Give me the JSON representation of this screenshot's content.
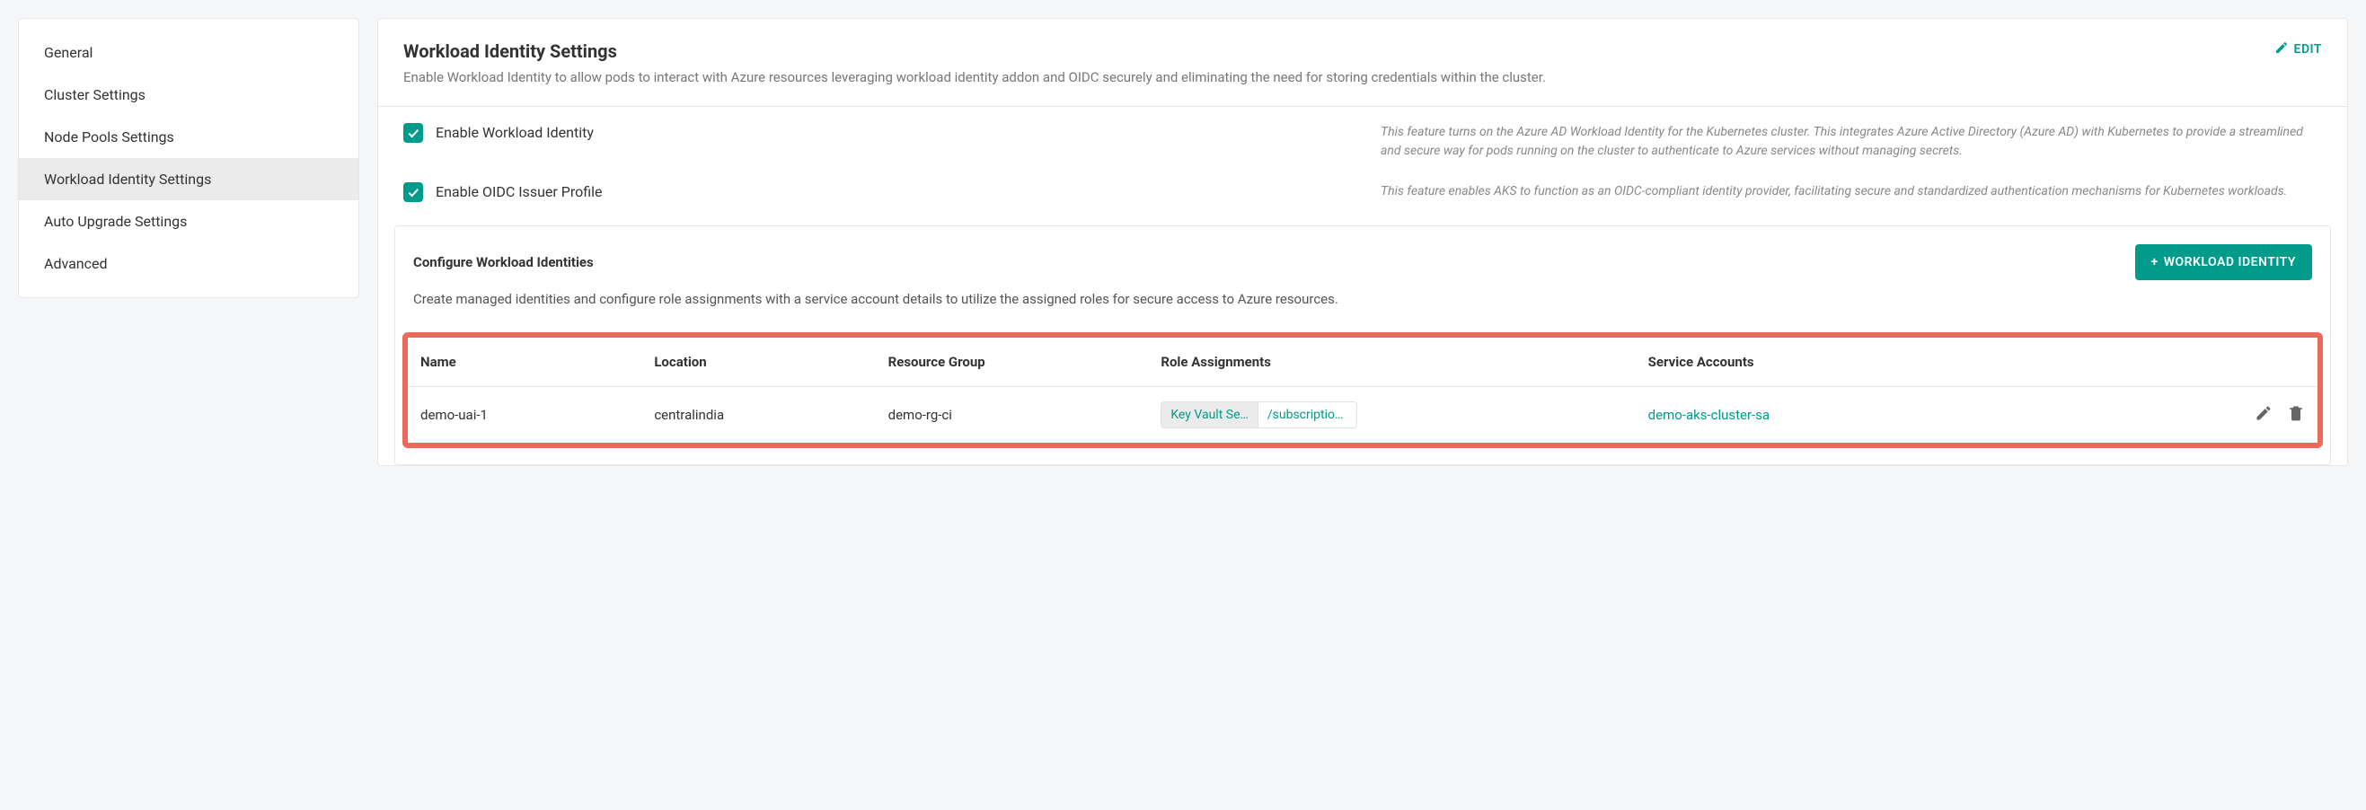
{
  "sidebar": {
    "items": [
      {
        "label": "General",
        "active": false
      },
      {
        "label": "Cluster Settings",
        "active": false
      },
      {
        "label": "Node Pools Settings",
        "active": false
      },
      {
        "label": "Workload Identity Settings",
        "active": true
      },
      {
        "label": "Auto Upgrade Settings",
        "active": false
      },
      {
        "label": "Advanced",
        "active": false
      }
    ]
  },
  "header": {
    "title": "Workload Identity Settings",
    "subtitle": "Enable Workload Identity to allow pods to interact with Azure resources leveraging workload identity addon and OIDC securely and eliminating the need for storing credentials within the cluster.",
    "edit_label": "EDIT"
  },
  "features": [
    {
      "label": "Enable Workload Identity",
      "checked": true,
      "description": "This feature turns on the Azure AD Workload Identity for the Kubernetes cluster. This integrates Azure Active Directory (Azure AD) with Kubernetes to provide a streamlined and secure way for pods running on the cluster to authenticate to Azure services without managing secrets."
    },
    {
      "label": "Enable OIDC Issuer Profile",
      "checked": true,
      "description": "This feature enables AKS to function as an OIDC-compliant identity provider, facilitating secure and standardized authentication mechanisms for Kubernetes workloads."
    }
  ],
  "config": {
    "title": "Configure Workload Identities",
    "add_button": "WORKLOAD IDENTITY",
    "description": "Create managed identities and configure role assignments with a service account details to utilize the assigned roles for secure access to Azure resources."
  },
  "table": {
    "headers": {
      "name": "Name",
      "location": "Location",
      "resource_group": "Resource Group",
      "role_assignments": "Role Assignments",
      "service_accounts": "Service Accounts"
    },
    "rows": [
      {
        "name": "demo-uai-1",
        "location": "centralindia",
        "resource_group": "demo-rg-ci",
        "role_key": "Key Vault Se…",
        "role_val": "/subscription…",
        "service_account": "demo-aks-cluster-sa"
      }
    ]
  }
}
